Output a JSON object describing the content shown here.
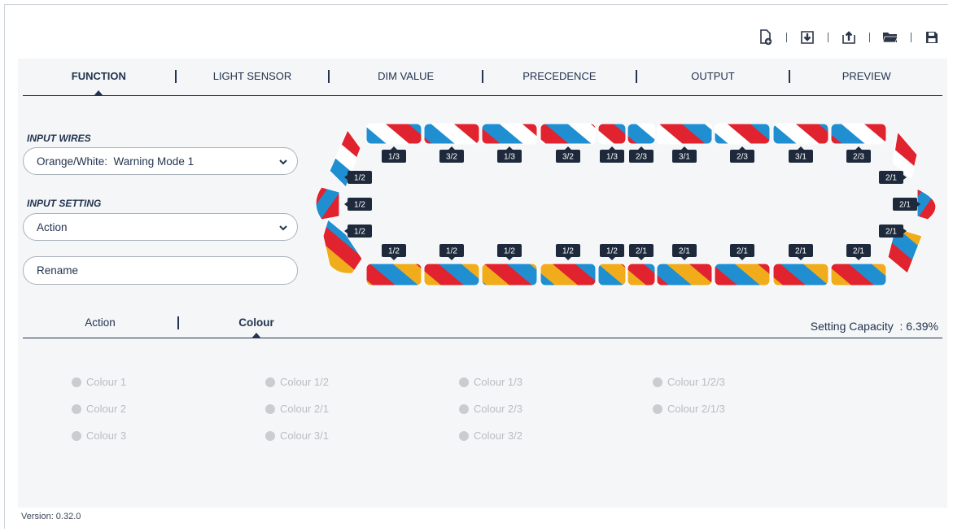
{
  "toolbar": {
    "icons": [
      "new-file-icon",
      "import-icon",
      "export-icon",
      "open-folder-icon",
      "save-icon"
    ]
  },
  "tabs": [
    {
      "label": "FUNCTION",
      "active": true
    },
    {
      "label": "LIGHT SENSOR",
      "active": false
    },
    {
      "label": "DIM VALUE",
      "active": false
    },
    {
      "label": "PRECEDENCE",
      "active": false
    },
    {
      "label": "OUTPUT",
      "active": false
    },
    {
      "label": "PREVIEW",
      "active": false
    }
  ],
  "input_wires": {
    "label": "INPUT WIRES",
    "value": "Orange/White:  Warning Mode 1"
  },
  "input_setting": {
    "label": "INPUT SETTING",
    "value": "Action"
  },
  "rename": {
    "label": "Rename"
  },
  "lightbar": {
    "top_labels": [
      "1/3",
      "3/2",
      "1/3",
      "3/2",
      "1/3",
      "2/3",
      "3/1",
      "2/3",
      "3/1",
      "2/3"
    ],
    "bottom_labels": [
      "1/2",
      "1/2",
      "1/2",
      "1/2",
      "1/2",
      "2/1",
      "2/1",
      "2/1",
      "2/1",
      "2/1"
    ],
    "left_labels": [
      "1/2",
      "1/2",
      "1/2"
    ],
    "right_labels": [
      "2/1",
      "2/1",
      "2/1"
    ],
    "colors": {
      "red": "#e0232e",
      "blue": "#1f8fd2",
      "amber": "#f0ac1b",
      "white": "#ffffff",
      "tag": "#1e2a3c"
    }
  },
  "subtabs": [
    {
      "label": "Action",
      "active": false
    },
    {
      "label": "Colour",
      "active": true
    }
  ],
  "capacity": {
    "text": "Setting Capacity  : 6.39%"
  },
  "colour_options": [
    [
      "Colour 1",
      "Colour 2",
      "Colour 3"
    ],
    [
      "Colour 1/2",
      "Colour 2/1",
      "Colour 3/1"
    ],
    [
      "Colour 1/3",
      "Colour 2/3",
      "Colour 3/2"
    ],
    [
      "Colour 1/2/3",
      "Colour 2/1/3"
    ]
  ],
  "version": "Version: 0.32.0"
}
